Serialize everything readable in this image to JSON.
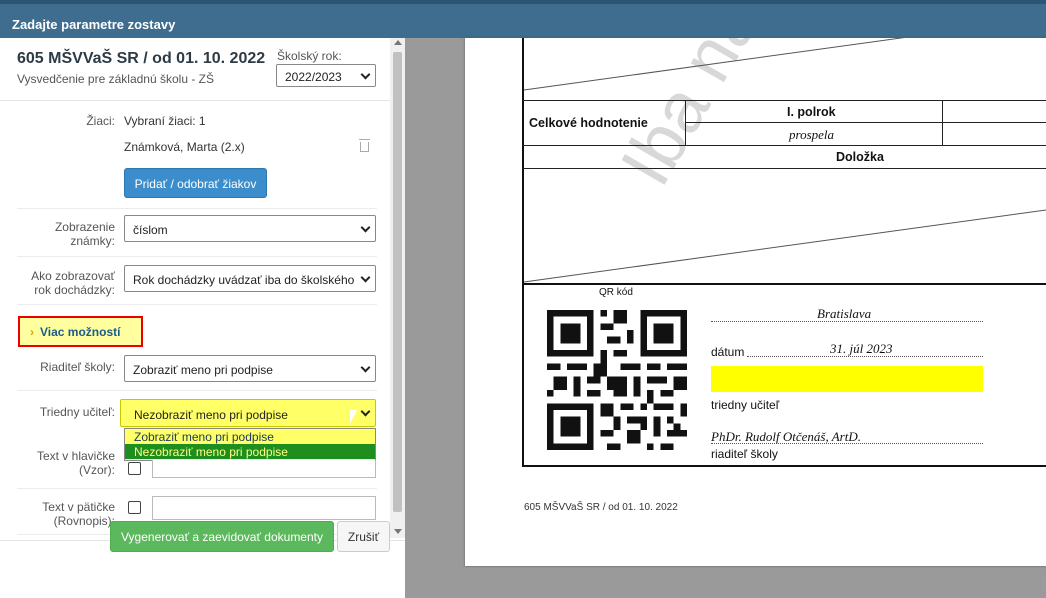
{
  "window": {
    "title": "Zadajte parametre zostavy"
  },
  "header": {
    "title": "605 MŠVVaŠ SR / od 01. 10. 2022",
    "subtitle": "Vysvedčenie pre základnú školu - ZŠ",
    "year_label": "Školský rok:",
    "year_value": "2022/2023"
  },
  "students": {
    "label": "Žiaci:",
    "selected_text": "Vybraní žiaci: 1",
    "student_name": "Známková, Marta (2.x)",
    "add_button": "Pridať / odobrať žiakov"
  },
  "form": {
    "grade_display_label": "Zobrazenie známky:",
    "grade_display_value": "číslom",
    "attendance_label": "Ako zobrazovať rok dochádzky:",
    "attendance_value": "Rok dochádzky uvádzať iba do školského",
    "more_options": "Viac možností",
    "director_label": "Riaditeľ školy:",
    "director_value": "Zobraziť meno pri podpise",
    "class_teacher_label": "Triedny učiteľ:",
    "class_teacher_value": "Nezobraziť meno pri podpise",
    "class_teacher_options": [
      "Zobraziť meno pri podpise",
      "Nezobraziť meno pri podpise"
    ],
    "header_text_label": "Text v hlavičke (Vzor):",
    "footer_text_label": "Text v pätičke (Rovnopis):"
  },
  "actions": {
    "generate": "Vygenerovať a zaevidovať dokumenty",
    "cancel": "Zrušiť"
  },
  "preview": {
    "watermark": "Iba náhľa",
    "overall_eval": "Celkové hodnotenie",
    "semester": "I. polrok",
    "result": "prospela",
    "clause": "Doložka",
    "qr_label": "QR kód",
    "city": "Bratislava",
    "date_label": "dátum",
    "date_value": "31. júl 2023",
    "class_teacher": "triedny učiteľ",
    "director_name": "PhDr. Rudolf Otčenáš, ArtD.",
    "director_role": "riaditeľ školy",
    "footer": "605 MŠVVaŠ SR / od 01. 10. 2022"
  }
}
